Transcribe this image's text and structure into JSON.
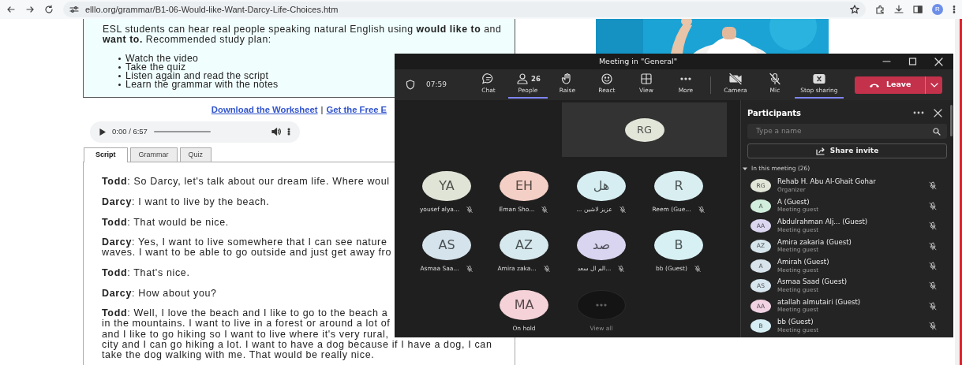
{
  "browser": {
    "url": "elllo.org/grammar/B1-06-Would-like-Want-Darcy-Life-Choices.htm",
    "profile": "R"
  },
  "page": {
    "intro": "ESL students can hear real people speaking natural English using **would like to** and **want to.** Recommended study plan:",
    "plan": [
      "Watch the video",
      "Take the quiz",
      "Listen again and read the script",
      "Learn the grammar with the notes"
    ],
    "links": [
      "Download the Worksheet",
      "Get the Free E"
    ],
    "link_separator": "|",
    "audio": {
      "time": "0:00 / 6:57"
    },
    "tabs": [
      {
        "label": "Script",
        "selected": true
      },
      {
        "label": "Grammar",
        "selected": false
      },
      {
        "label": "Quiz",
        "selected": false
      }
    ],
    "script": [
      {
        "lines": [
          "**Todd**: So Darcy, let's talk about our dream life. Where woul"
        ]
      },
      {
        "lines": [
          "**Darcy**: I want to live by the beach."
        ]
      },
      {
        "lines": [
          "**Todd**: That would be nice."
        ]
      },
      {
        "lines": [
          "**Darcy**: Yes, I want to live somewhere that I can see nature",
          "waves. I want to be able to go outside and just get away fro"
        ]
      },
      {
        "lines": [
          "**Todd**: That's nice."
        ]
      },
      {
        "lines": [
          "**Darcy**: How about you?"
        ]
      },
      {
        "lines": [
          "**Todd**: Well, I love the beach and I like to go to the beach a",
          "in the mountains. I want to live in a forest or around a lot of",
          "and I like to go hiking so I want to live where it's very rural,",
          "city and I can go hiking a lot. I want to have a dog because if I have a dog, I can",
          "take the dog walking with me. That would be really nice."
        ]
      }
    ]
  },
  "meeting": {
    "title": "Meeting in \"General\"",
    "timer": "07:59",
    "toolbar": [
      {
        "kind": "chat",
        "label": "Chat",
        "active": false
      },
      {
        "kind": "people",
        "label": "People",
        "count": "26",
        "active": true
      },
      {
        "kind": "raise",
        "label": "Raise",
        "active": false
      },
      {
        "kind": "react",
        "label": "React",
        "active": false
      },
      {
        "kind": "view",
        "label": "View",
        "active": false
      },
      {
        "kind": "more",
        "label": "More",
        "active": false
      },
      {
        "kind": "camera",
        "label": "Camera",
        "active": false,
        "on": false
      },
      {
        "kind": "mic",
        "label": "Mic",
        "active": false,
        "on": false
      },
      {
        "kind": "share",
        "label": "Stop sharing",
        "active": true
      }
    ],
    "leave": "Leave",
    "featured": {
      "initials": "RG",
      "color": "#e2e6d9"
    },
    "tiles": [
      {
        "kind": "person",
        "initials": "YA",
        "name": "yousef alya...",
        "color": "#dfe4d6",
        "muted": true
      },
      {
        "kind": "person",
        "initials": "EH",
        "name": "Eman Sho...",
        "color": "#f4cfc6",
        "muted": true
      },
      {
        "kind": "person",
        "initials": "هل",
        "name": "عزيز لاشين ...",
        "color": "#d6eef2",
        "muted": true
      },
      {
        "kind": "person",
        "initials": "R",
        "name": "Reem (Gue...",
        "color": "#d8eef1",
        "muted": true
      },
      {
        "kind": "person",
        "initials": "AS",
        "name": "Asmaa Saa...",
        "color": "#d5e3ec",
        "muted": true
      },
      {
        "kind": "person",
        "initials": "AZ",
        "name": "Amira zaka...",
        "color": "#d6e9ee",
        "muted": true
      },
      {
        "kind": "person",
        "initials": "صد",
        "name": "...الم ال سعد",
        "color": "#d9d4ef",
        "muted": true
      },
      {
        "kind": "person",
        "initials": "B",
        "name": "bb (Guest)",
        "color": "#d7f0f4",
        "muted": true
      },
      {
        "kind": "person",
        "initials": "MA",
        "name": "On hold",
        "color": "#f4d2d8",
        "muted": false
      },
      {
        "kind": "overflow",
        "name": "View all"
      }
    ],
    "panel": {
      "title": "Participants",
      "search": {
        "placeholder": "Type a name"
      },
      "share": "Share invite",
      "section": {
        "label": "In this meeting (26)",
        "expanded": true
      },
      "people": [
        {
          "initials": "RG",
          "name": "Rehab H. Abu Al-Ghait Gohar",
          "role": "Organizer",
          "color": "#e2e6d9",
          "muted": true
        },
        {
          "initials": "A",
          "name": "A (Guest)",
          "role": "Meeting guest",
          "color": "#d2efdd",
          "muted": true
        },
        {
          "initials": "AA",
          "name": "Abdulrahman Alj... (Guest)",
          "role": "Meeting guest",
          "color": "#dcd6f0",
          "muted": true
        },
        {
          "initials": "AZ",
          "name": "Amira zakaria (Guest)",
          "role": "Meeting guest",
          "color": "#d7e6ec",
          "muted": true
        },
        {
          "initials": "A",
          "name": "Amirah (Guest)",
          "role": "Meeting guest",
          "color": "#d8e3eb",
          "muted": true
        },
        {
          "initials": "AS",
          "name": "Asmaa Saad (Guest)",
          "role": "Meeting guest",
          "color": "#d8e7ef",
          "muted": true
        },
        {
          "initials": "AA",
          "name": "atallah almutairi (Guest)",
          "role": "Meeting guest",
          "color": "#f1d3e3",
          "muted": true
        },
        {
          "initials": "B",
          "name": "bb (Guest)",
          "role": "Meeting guest",
          "color": "#d6eef4",
          "muted": true
        }
      ]
    }
  }
}
